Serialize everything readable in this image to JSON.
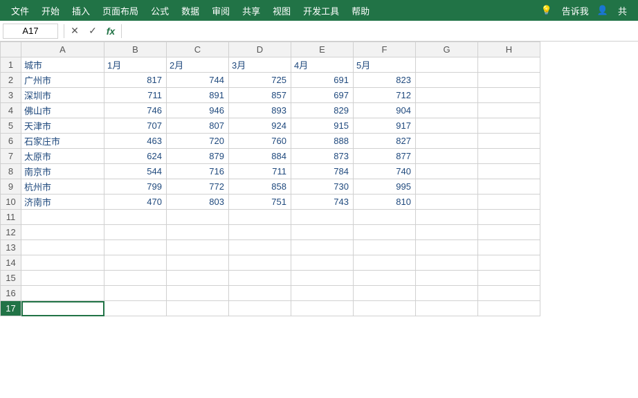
{
  "menu": {
    "items": [
      "文件",
      "开始",
      "插入",
      "页面布局",
      "公式",
      "数据",
      "审阅",
      "共享",
      "视图",
      "开发工具",
      "帮助"
    ],
    "right_items": [
      "告诉我",
      "共"
    ]
  },
  "formula_bar": {
    "cell_ref": "A17",
    "cancel_icon": "✕",
    "confirm_icon": "✓",
    "function_icon": "fx",
    "formula_value": ""
  },
  "columns": [
    "A",
    "B",
    "C",
    "D",
    "E",
    "F",
    "G",
    "H"
  ],
  "rows": [
    {
      "num": 1,
      "A": "城市",
      "B": "1月",
      "C": "2月",
      "D": "3月",
      "E": "4月",
      "F": "5月",
      "G": "",
      "H": ""
    },
    {
      "num": 2,
      "A": "广州市",
      "B": "817",
      "C": "744",
      "D": "725",
      "E": "691",
      "F": "823",
      "G": "",
      "H": ""
    },
    {
      "num": 3,
      "A": "深圳市",
      "B": "711",
      "C": "891",
      "D": "857",
      "E": "697",
      "F": "712",
      "G": "",
      "H": ""
    },
    {
      "num": 4,
      "A": "佛山市",
      "B": "746",
      "C": "946",
      "D": "893",
      "E": "829",
      "F": "904",
      "G": "",
      "H": ""
    },
    {
      "num": 5,
      "A": "天津市",
      "B": "707",
      "C": "807",
      "D": "924",
      "E": "915",
      "F": "917",
      "G": "",
      "H": ""
    },
    {
      "num": 6,
      "A": "石家庄市",
      "B": "463",
      "C": "720",
      "D": "760",
      "E": "888",
      "F": "827",
      "G": "",
      "H": ""
    },
    {
      "num": 7,
      "A": "太原市",
      "B": "624",
      "C": "879",
      "D": "884",
      "E": "873",
      "F": "877",
      "G": "",
      "H": ""
    },
    {
      "num": 8,
      "A": "南京市",
      "B": "544",
      "C": "716",
      "D": "711",
      "E": "784",
      "F": "740",
      "G": "",
      "H": ""
    },
    {
      "num": 9,
      "A": "杭州市",
      "B": "799",
      "C": "772",
      "D": "858",
      "E": "730",
      "F": "995",
      "G": "",
      "H": ""
    },
    {
      "num": 10,
      "A": "济南市",
      "B": "470",
      "C": "803",
      "D": "751",
      "E": "743",
      "F": "810",
      "G": "",
      "H": ""
    },
    {
      "num": 11,
      "A": "",
      "B": "",
      "C": "",
      "D": "",
      "E": "",
      "F": "",
      "G": "",
      "H": ""
    },
    {
      "num": 12,
      "A": "",
      "B": "",
      "C": "",
      "D": "",
      "E": "",
      "F": "",
      "G": "",
      "H": ""
    },
    {
      "num": 13,
      "A": "",
      "B": "",
      "C": "",
      "D": "",
      "E": "",
      "F": "",
      "G": "",
      "H": ""
    },
    {
      "num": 14,
      "A": "",
      "B": "",
      "C": "",
      "D": "",
      "E": "",
      "F": "",
      "G": "",
      "H": ""
    },
    {
      "num": 15,
      "A": "",
      "B": "",
      "C": "",
      "D": "",
      "E": "",
      "F": "",
      "G": "",
      "H": ""
    },
    {
      "num": 16,
      "A": "",
      "B": "",
      "C": "",
      "D": "",
      "E": "",
      "F": "",
      "G": "",
      "H": ""
    },
    {
      "num": 17,
      "A": "",
      "B": "",
      "C": "",
      "D": "",
      "E": "",
      "F": "",
      "G": "",
      "H": ""
    }
  ],
  "selected_cell": "A17"
}
